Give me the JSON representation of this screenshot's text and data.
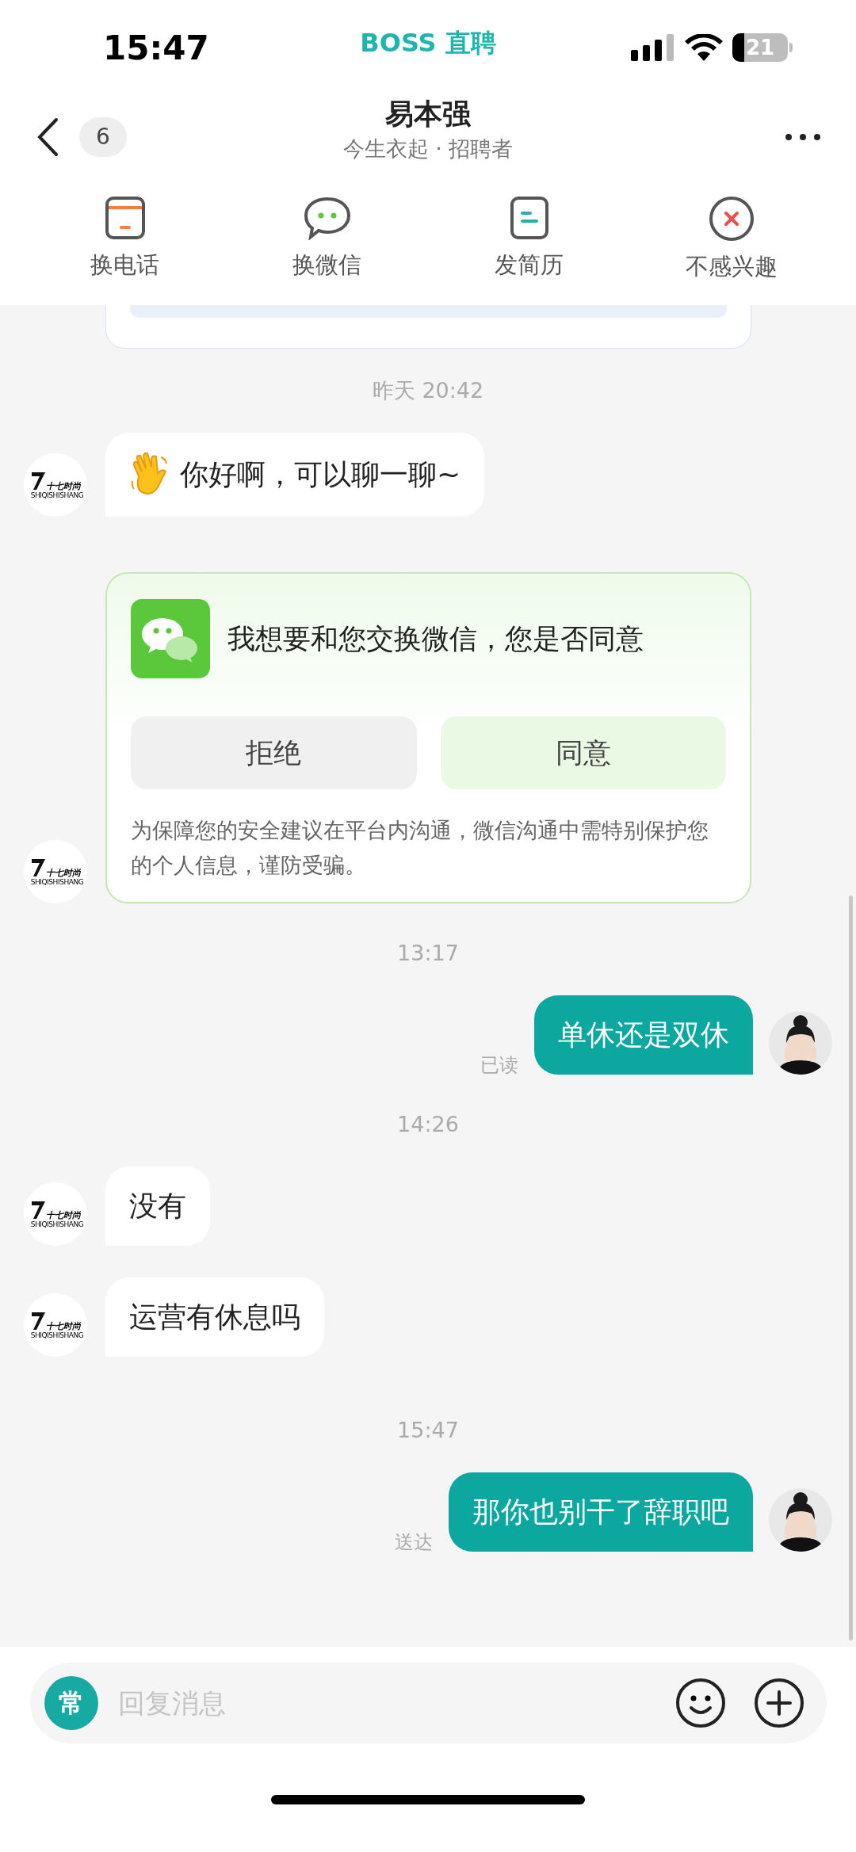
{
  "status_bar": {
    "time": "15:47",
    "app": "BOSS 直聘",
    "battery": "21"
  },
  "header": {
    "back_badge": "6",
    "title": "易本强",
    "subtitle": "今生衣起 · 招聘者"
  },
  "actions": [
    {
      "kind": "phone",
      "label": "换电话"
    },
    {
      "kind": "wechat",
      "label": "换微信"
    },
    {
      "kind": "resume",
      "label": "发简历"
    },
    {
      "kind": "not_interested",
      "label": "不感兴趣"
    }
  ],
  "messages": [
    {
      "kind": "partial_card"
    },
    {
      "kind": "time",
      "text": "昨天 20:42"
    },
    {
      "kind": "greeting",
      "text": "你好啊，可以聊一聊~",
      "avatar": {
        "name": "十七时尚",
        "sub": "SHIQISHISHANG"
      }
    },
    {
      "kind": "exchange_request",
      "text": "我想要和您交换微信，您是否同意",
      "buttons": [
        {
          "kind": "decline",
          "label": "拒绝"
        },
        {
          "kind": "accept",
          "label": "同意"
        }
      ],
      "note": "为保障您的安全建议在平台内沟通，微信沟通中需特别保护您的个人信息，谨防受骗。",
      "avatar": {
        "name": "十七时尚",
        "sub": "SHIQISHISHANG"
      }
    },
    {
      "kind": "time",
      "text": "13:17"
    },
    {
      "kind": "sent",
      "text": "单休还是双休",
      "status": "已读"
    },
    {
      "kind": "time",
      "text": "14:26"
    },
    {
      "kind": "received",
      "text": "没有",
      "avatar": {
        "name": "十七时尚",
        "sub": "SHIQISHISHANG"
      }
    },
    {
      "kind": "received",
      "text": "运营有休息吗",
      "avatar": {
        "name": "十七时尚",
        "sub": "SHIQISHISHANG"
      }
    },
    {
      "kind": "time",
      "text": "15:47"
    },
    {
      "kind": "sent",
      "text": "那你也别干了辞职吧",
      "status": "送达"
    }
  ],
  "composer": {
    "quick_label": "常",
    "placeholder": "回复消息"
  }
}
